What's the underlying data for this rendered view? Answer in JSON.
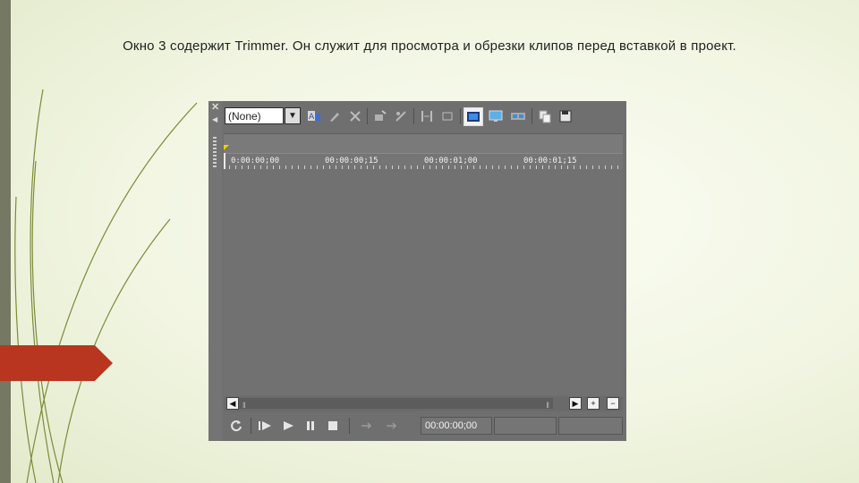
{
  "slide": {
    "heading": "Окно 3 содержит Trimmer. Он служит для просмотра и обрезки клипов перед вставкой в проект."
  },
  "trimmer": {
    "dropdown_value": "(None)",
    "toolbar_icons": [
      "auto-preview-icon",
      "pencil-icon",
      "delete-icon",
      "add-to-timeline-icon",
      "split-icon",
      "trim-left-icon",
      "trim-region-icon",
      "show-video-icon",
      "monitor-icon",
      "filmstrip-icon",
      "copy-icon",
      "save-icon"
    ],
    "ruler_timecodes": [
      "0:00:00;00",
      "00:00:00;15",
      "00:00:01;00",
      "00:00:01;15"
    ],
    "current_timecode": "00:00:00;00",
    "colors": {
      "panel": "#6f6f6f",
      "accent_marker": "#f1d000",
      "tab_red": "#b8361f"
    }
  }
}
